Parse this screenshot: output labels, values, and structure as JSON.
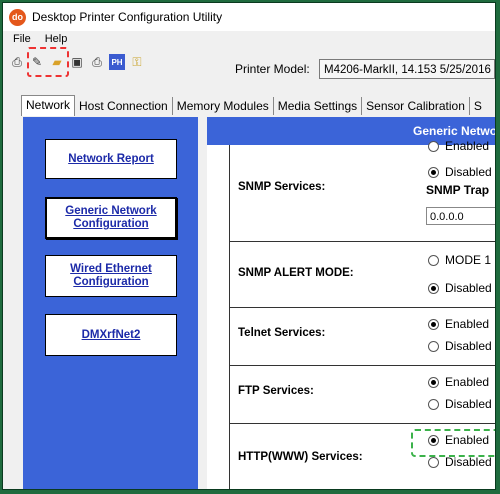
{
  "window": {
    "title": "Desktop Printer Configuration Utility",
    "app_icon_text": "do"
  },
  "menu": [
    "File",
    "Help"
  ],
  "toolbar": {
    "icons": [
      "printer-icon",
      "wrench-icon",
      "folder-icon",
      "floppy-save-icon",
      "printer-small-icon",
      "ph-icon",
      "key-icon"
    ],
    "ph_label": "PH"
  },
  "printer": {
    "label": "Printer Model:",
    "value": "M4206-MarkII, 14.153 5/25/2016"
  },
  "tabs": [
    "Network",
    "Host Connection",
    "Memory Modules",
    "Media Settings",
    "Sensor Calibration",
    "S"
  ],
  "nav": [
    "Network Report",
    "Generic Network Configuration",
    "Wired Ethernet Configuration",
    "DMXrfNet2"
  ],
  "section_title": "Generic Network",
  "rows": {
    "snmp": {
      "label": "SNMP Services:",
      "opt1": "Enabled",
      "opt2": "Disabled",
      "trap_label": "SNMP Trap",
      "trap_value": "0.0.0.0"
    },
    "alert": {
      "label": "SNMP ALERT MODE:",
      "opt1": "MODE 1",
      "opt2": "Disabled"
    },
    "telnet": {
      "label": "Telnet Services:",
      "opt1": "Enabled",
      "opt2": "Disabled"
    },
    "ftp": {
      "label": "FTP Services:",
      "opt1": "Enabled",
      "opt2": "Disabled"
    },
    "http": {
      "label": "HTTP(WWW) Services:",
      "opt1": "Enabled",
      "opt2": "Disabled"
    }
  }
}
